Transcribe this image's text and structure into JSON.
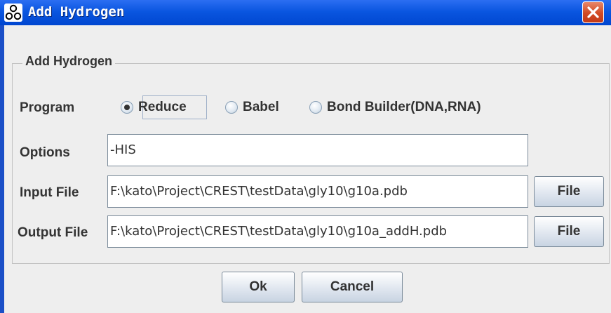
{
  "window": {
    "title": "Add Hydrogen",
    "icon": "molecule-icon",
    "close_icon": "close-icon"
  },
  "group": {
    "title": "Add Hydrogen"
  },
  "program": {
    "label": "Program",
    "options": [
      {
        "label": "Reduce",
        "selected": true
      },
      {
        "label": "Babel",
        "selected": false
      },
      {
        "label": "Bond Builder(DNA,RNA)",
        "selected": false
      }
    ]
  },
  "options": {
    "label": "Options",
    "value": "-HIS"
  },
  "input_file": {
    "label": "Input File",
    "value": "F:\\kato\\Project\\CREST\\testData\\gly10\\g10a.pdb",
    "button": "File"
  },
  "output_file": {
    "label": "Output File",
    "value": "F:\\kato\\Project\\CREST\\testData\\gly10\\g10a_addH.pdb",
    "button": "File"
  },
  "actions": {
    "ok": "Ok",
    "cancel": "Cancel"
  },
  "colors": {
    "titlebar": "#0a56e0",
    "close": "#d24a24",
    "background": "#eeeeee"
  }
}
